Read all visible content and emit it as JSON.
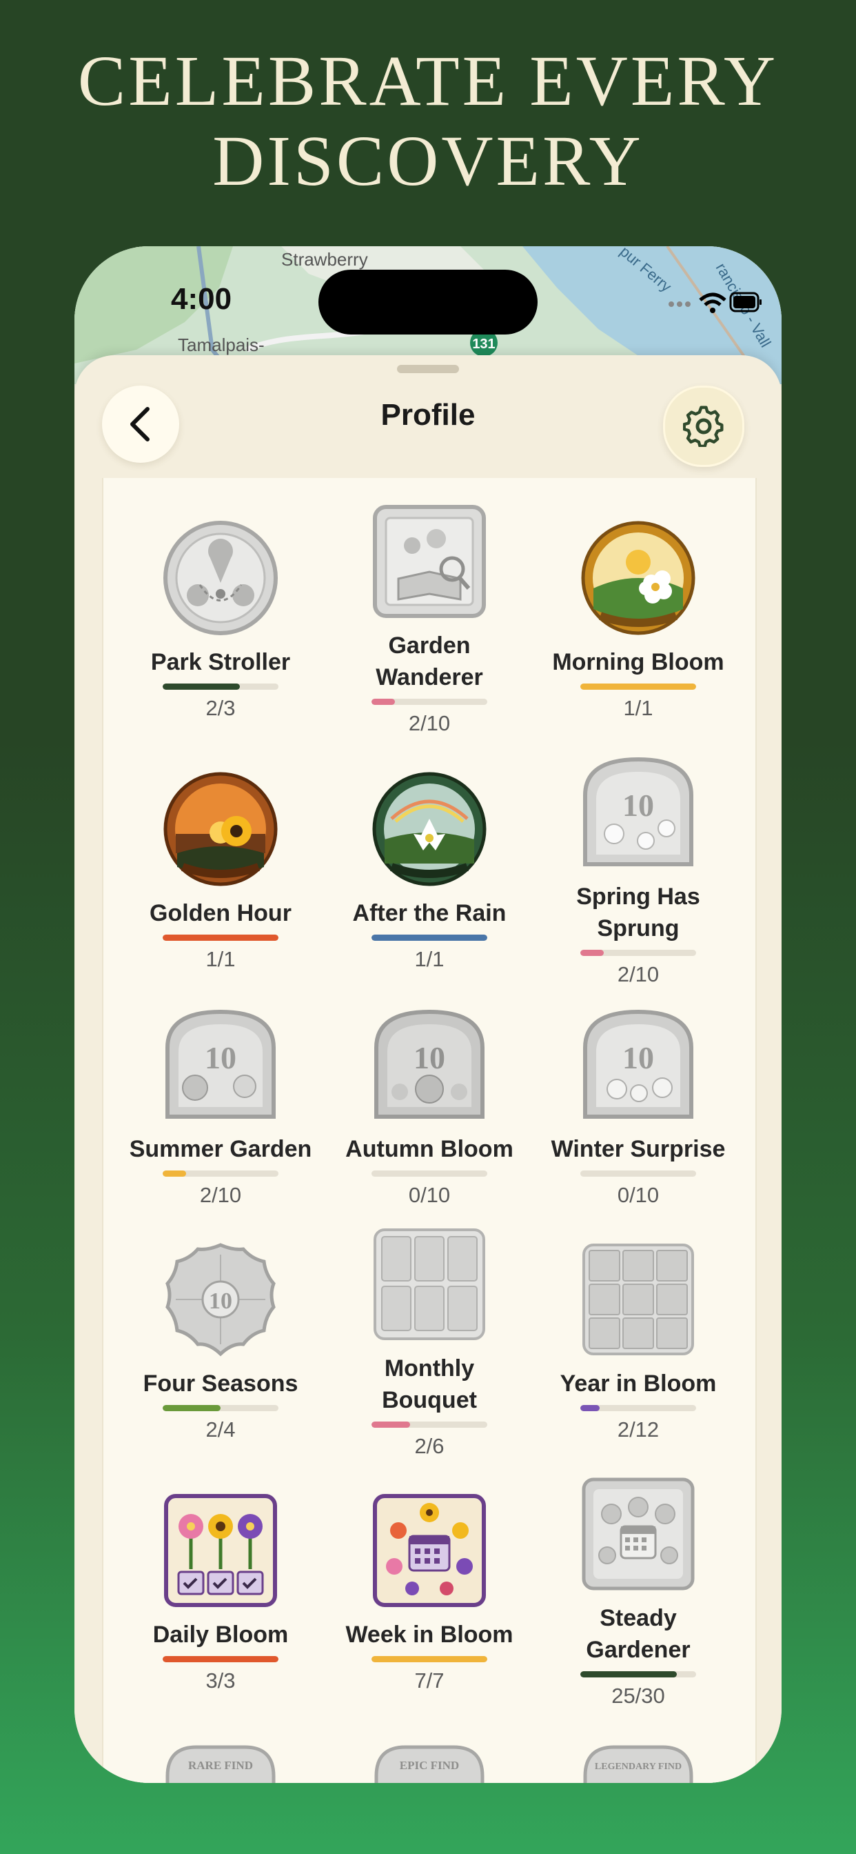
{
  "headline": {
    "line1": "CELEBRATE EVERY",
    "line2": "DISCOVERY"
  },
  "status_bar": {
    "time": "4:00"
  },
  "map": {
    "labels": [
      "Strawberry",
      "Tamalpais-",
      "131",
      "rancisco - Vall",
      "pur Ferry"
    ]
  },
  "header": {
    "title": "Profile",
    "back_icon": "chevron-left-icon",
    "settings_icon": "gear-icon"
  },
  "badges": [
    {
      "name": "Park Stroller",
      "count": "2/3",
      "progress": 0.667,
      "color": "#2e4a2c",
      "earned": false,
      "shape": "circle"
    },
    {
      "name": "Garden Wanderer",
      "count": "2/10",
      "progress": 0.2,
      "color": "#e0788e",
      "earned": false,
      "shape": "square"
    },
    {
      "name": "Morning Bloom",
      "count": "1/1",
      "progress": 1.0,
      "color": "#f0b43a",
      "earned": true,
      "shape": "circle"
    },
    {
      "name": "Golden Hour",
      "count": "1/1",
      "progress": 1.0,
      "color": "#e0582c",
      "earned": true,
      "shape": "circle"
    },
    {
      "name": "After the Rain",
      "count": "1/1",
      "progress": 1.0,
      "color": "#4a76a8",
      "earned": true,
      "shape": "circle"
    },
    {
      "name": "Spring Has Sprung",
      "count": "2/10",
      "progress": 0.2,
      "color": "#e0788e",
      "earned": false,
      "shape": "arch"
    },
    {
      "name": "Summer Garden",
      "count": "2/10",
      "progress": 0.2,
      "color": "#f0b43a",
      "earned": false,
      "shape": "arch"
    },
    {
      "name": "Autumn Bloom",
      "count": "0/10",
      "progress": 0.0,
      "color": "#e0582c",
      "earned": false,
      "shape": "arch"
    },
    {
      "name": "Winter Surprise",
      "count": "0/10",
      "progress": 0.0,
      "color": "#4a76a8",
      "earned": false,
      "shape": "arch"
    },
    {
      "name": "Four Seasons",
      "count": "2/4",
      "progress": 0.5,
      "color": "#6a9a3a",
      "earned": false,
      "shape": "scallop"
    },
    {
      "name": "Monthly Bouquet",
      "count": "2/6",
      "progress": 0.333,
      "color": "#e0788e",
      "earned": false,
      "shape": "square"
    },
    {
      "name": "Year in Bloom",
      "count": "2/12",
      "progress": 0.167,
      "color": "#7a55b5",
      "earned": false,
      "shape": "square"
    },
    {
      "name": "Daily Bloom",
      "count": "3/3",
      "progress": 1.0,
      "color": "#e0582c",
      "earned": true,
      "shape": "square-purple"
    },
    {
      "name": "Week in Bloom",
      "count": "7/7",
      "progress": 1.0,
      "color": "#f0b43a",
      "earned": true,
      "shape": "square-purple"
    },
    {
      "name": "Steady Gardener",
      "count": "25/30",
      "progress": 0.833,
      "color": "#2e4a2c",
      "earned": false,
      "shape": "square"
    }
  ],
  "partial_badges": [
    {
      "label": "RARE FIND"
    },
    {
      "label": "EPIC FIND"
    },
    {
      "label": "LEGENDARY FIND"
    }
  ]
}
